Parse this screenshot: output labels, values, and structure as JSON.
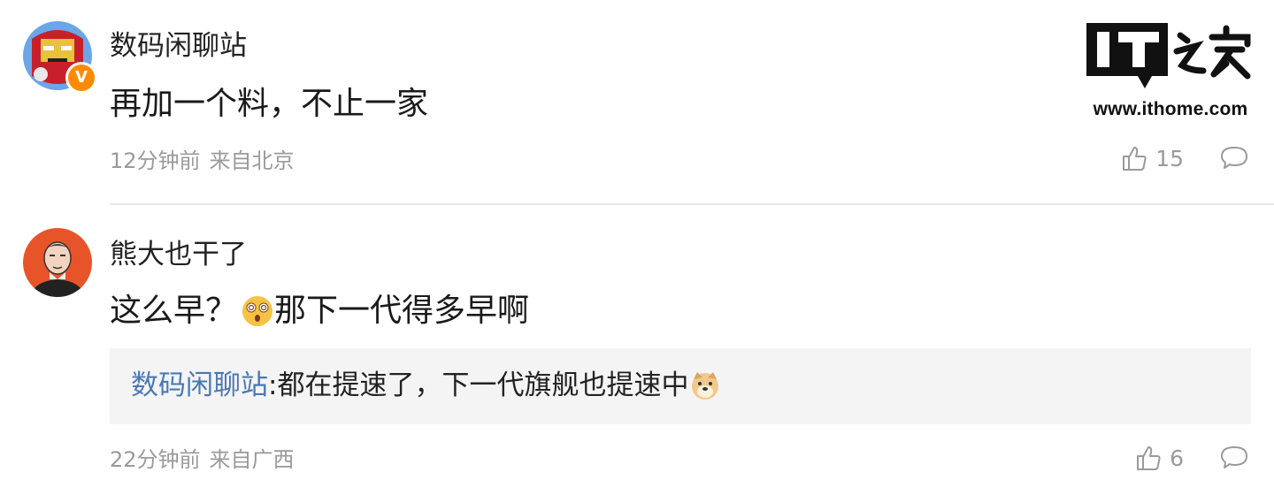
{
  "logo": {
    "brand_text": "IT之家",
    "url": "www.ithome.com"
  },
  "comments": [
    {
      "username": "数码闲聊站",
      "avatar_icon": "iron-man-avatar",
      "verified_badge": "V",
      "content": "再加一个料，不止一家",
      "time": "12分钟前",
      "location": "来自北京",
      "likes": "15"
    },
    {
      "username": "熊大也干了",
      "avatar_icon": "man-portrait-avatar",
      "content_before_emoji": "这么早？",
      "content_emoji": "dizzy-face-emoji",
      "content_after_emoji": "那下一代得多早啊",
      "reply": {
        "author": "数码闲聊站",
        "separator": ":",
        "body": "都在提速了，下一代旗舰也提速中",
        "emoji": "doge-emoji"
      },
      "time": "22分钟前",
      "location": "来自广西",
      "likes": "6"
    }
  ],
  "colors": {
    "reply_author": "#4a78b5",
    "meta_gray": "#9a9a9a",
    "reply_bg": "#f4f4f4",
    "verified_orange": "#ff8a00"
  }
}
